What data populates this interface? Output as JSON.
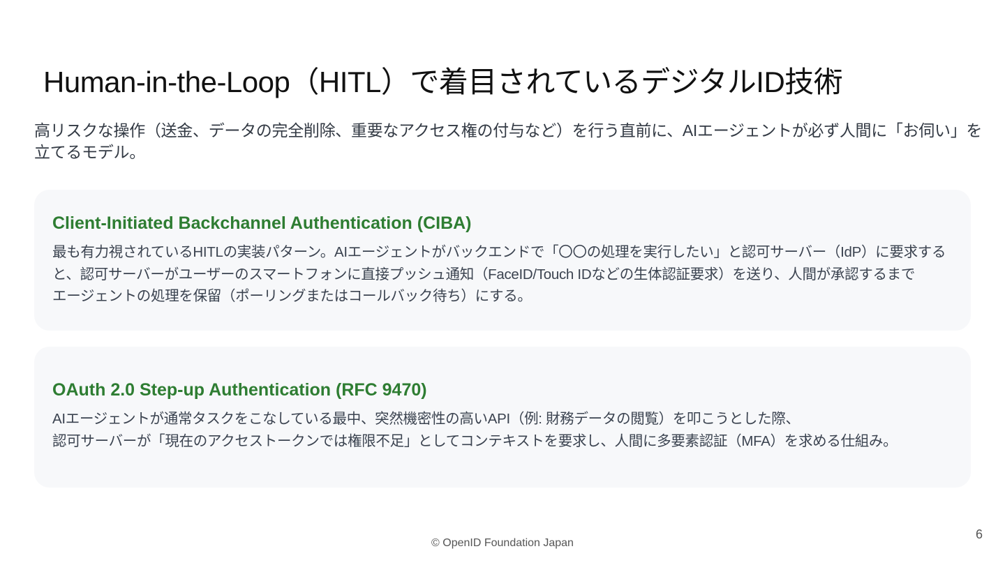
{
  "slide": {
    "title": "Human-in-the-Loop（HITL）で着目されているデジタルID技術",
    "intro": "高リスクな操作（送金、データの完全削除、重要なアクセス権の付与など）を行う直前に、AIエージェントが必ず人間に「お伺い」を立てるモデル。",
    "cards": [
      {
        "title": "Client-Initiated Backchannel Authentication (CIBA)",
        "lines": [
          "最も有力視されているHITLの実装パターン。AIエージェントがバックエンドで「〇〇の処理を実行したい」と認可サーバー（IdP）に要求する",
          "と、認可サーバーがユーザーのスマートフォンに直接プッシュ通知（FaceID/Touch IDなどの生体認証要求）を送り、人間が承認するまで",
          "エージェントの処理を保留（ポーリングまたはコールバック待ち）にする。"
        ]
      },
      {
        "title": "OAuth 2.0 Step-up Authentication (RFC 9470)",
        "lines": [
          "AIエージェントが通常タスクをこなしている最中、突然機密性の高いAPI（例: 財務データの閲覧）を叩こうとした際、",
          "認可サーバーが「現在のアクセストークンでは権限不足」としてコンテキストを要求し、人間に多要素認証（MFA）を求める仕組み。"
        ]
      }
    ],
    "footer": "© OpenID Foundation Japan",
    "page_number": "6"
  },
  "colors": {
    "card_title": "#2e7d32",
    "card_background": "#f7f8fa",
    "title_text": "#111111",
    "body_text": "#3b4350"
  }
}
